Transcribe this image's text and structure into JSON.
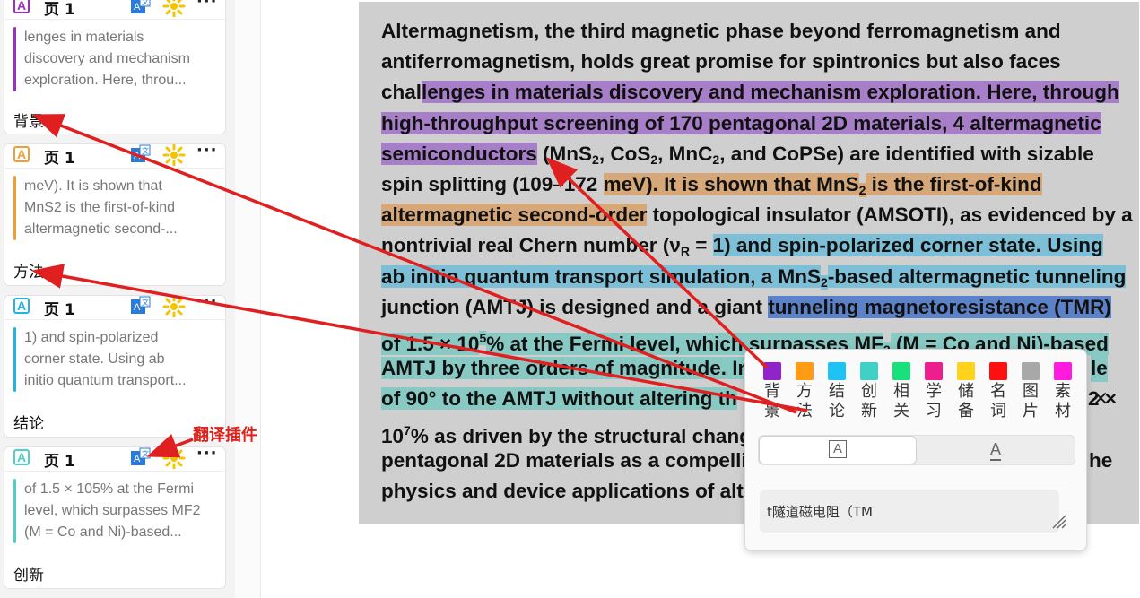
{
  "sidebar": {
    "cards": [
      {
        "page": "页 1",
        "color": "#9b30c0",
        "excerpt": [
          "lenges in materials",
          "discovery and mechanism",
          "exploration. Here, throu..."
        ],
        "tag": "背景"
      },
      {
        "page": "页 1",
        "color": "#f0a030",
        "excerpt": [
          "meV). It is shown that",
          "MnS2 is the first-of-kind",
          "altermagnetic second-..."
        ],
        "tag": "方法"
      },
      {
        "page": "页 1",
        "color": "#1fb6e0",
        "excerpt": [
          "1) and spin-polarized",
          "corner state. Using ab",
          "initio quantum transport..."
        ],
        "tag": "结论"
      },
      {
        "page": "页 1",
        "color": "#4fcfc8",
        "excerpt": [
          "of 1.5 × 105% at the Fermi",
          "level, which surpasses MF2",
          "(M = Co and Ni)-based..."
        ],
        "tag": "创新"
      }
    ]
  },
  "annotation": {
    "plugin_label": "翻译插件"
  },
  "doc": {
    "lines": [
      [
        {
          "t": "Altermagnetism, the third magnetic phase beyond ferromagnetism and"
        }
      ],
      [
        {
          "t": "antiferromagnetism, holds great promise for spintronics but also faces"
        }
      ],
      [
        {
          "t": "chal"
        },
        {
          "t": "lenges in materials discovery and mechanism exploration. Here, through",
          "c": "#a77fc8"
        }
      ],
      [
        {
          "t": "high-throughput screening of 170 pentagonal 2D materials, 4 altermagnetic",
          "c": "#a77fc8"
        }
      ],
      [
        {
          "t": "semiconductors",
          "c": "#a77fc8"
        },
        {
          "t": " (MnS"
        },
        {
          "t": "2",
          "s": "sub"
        },
        {
          "t": ", CoS"
        },
        {
          "t": "2",
          "s": "sub"
        },
        {
          "t": ", MnC"
        },
        {
          "t": "2",
          "s": "sub"
        },
        {
          "t": ", and CoPSe) are identified with sizable"
        }
      ],
      [
        {
          "t": "spin splitting (109–172 "
        },
        {
          "t": "meV). It is shown that MnS",
          "c": "#d6a778"
        },
        {
          "t": "2",
          "s": "sub",
          "c": "#d6a778"
        },
        {
          "t": " is the first-of-kind",
          "c": "#d6a778"
        }
      ],
      [
        {
          "t": "altermagnetic second-order",
          "c": "#d6a778"
        },
        {
          "t": " topological insulator (AMSOTI), as evidenced by a"
        }
      ],
      [
        {
          "t": "nontrivial real Chern number ("
        },
        {
          "t": "ν"
        },
        {
          "t": "R",
          "s": "sub"
        },
        {
          "t": " = "
        },
        {
          "t": "1) and spin-polarized corner state. Using",
          "c": "#7cbfd6"
        }
      ],
      [
        {
          "t": "ab initio quantum transport simulation, a MnS",
          "c": "#7cbfd6"
        },
        {
          "t": "2",
          "s": "sub",
          "c": "#7cbfd6"
        },
        {
          "t": "-based altermagnetic tunneling",
          "c": "#7cbfd6"
        }
      ],
      [
        {
          "t": "junction (AMTJ) is designed and a giant "
        },
        {
          "t": "tunneling magnetoresistance (TMR)",
          "c": "#5b82c8"
        }
      ],
      [
        {
          "t": "of 1.5 × 10",
          "c": "#88c9c4"
        },
        {
          "t": "5",
          "s": "sup",
          "c": "#88c9c4"
        },
        {
          "t": "% at the Fermi level, which surpasses MF",
          "c": "#88c9c4"
        },
        {
          "t": "2",
          "s": "sub",
          "c": "#88c9c4"
        },
        {
          "t": " (M = Co and Ni)-based",
          "c": "#88c9c4"
        }
      ],
      [
        {
          "t": "AMTJ by three orders of magnitude. In",
          "c": "#88c9c4"
        }
      ],
      [
        {
          "t": "of 90° to the AMTJ without altering th",
          "c": "#88c9c4"
        }
      ],
      [
        {
          "t": "10"
        },
        {
          "t": "7",
          "s": "sup"
        },
        {
          "t": "% as driven by the structural chang"
        }
      ],
      [
        {
          "t": "pentagonal 2D materials as a compelli"
        }
      ],
      [
        {
          "t": "physics and device applications of alte"
        }
      ]
    ],
    "line_tails": [
      {
        "row": 11,
        "text": "le"
      },
      {
        "row": 12,
        "text": "2 ×"
      },
      {
        "row": 14,
        "text": "he"
      }
    ]
  },
  "popup": {
    "colors": [
      {
        "label": "背景",
        "hex": "#8e24c9"
      },
      {
        "label": "方法",
        "hex": "#ff9b14"
      },
      {
        "label": "结论",
        "hex": "#1ec2f4"
      },
      {
        "label": "创新",
        "hex": "#40d0c6"
      },
      {
        "label": "相关",
        "hex": "#18e07a"
      },
      {
        "label": "学习",
        "hex": "#ec1f8c"
      },
      {
        "label": "储备",
        "hex": "#ffd21c"
      },
      {
        "label": "名词",
        "hex": "#ff1010"
      },
      {
        "label": "图片",
        "hex": "#a8a8a8"
      },
      {
        "label": "素材",
        "hex": "#ff1ae0"
      }
    ],
    "style_highlight": "A",
    "style_underline": "A",
    "note_value": "t隧道磁电阻（TM",
    "close": "×"
  }
}
